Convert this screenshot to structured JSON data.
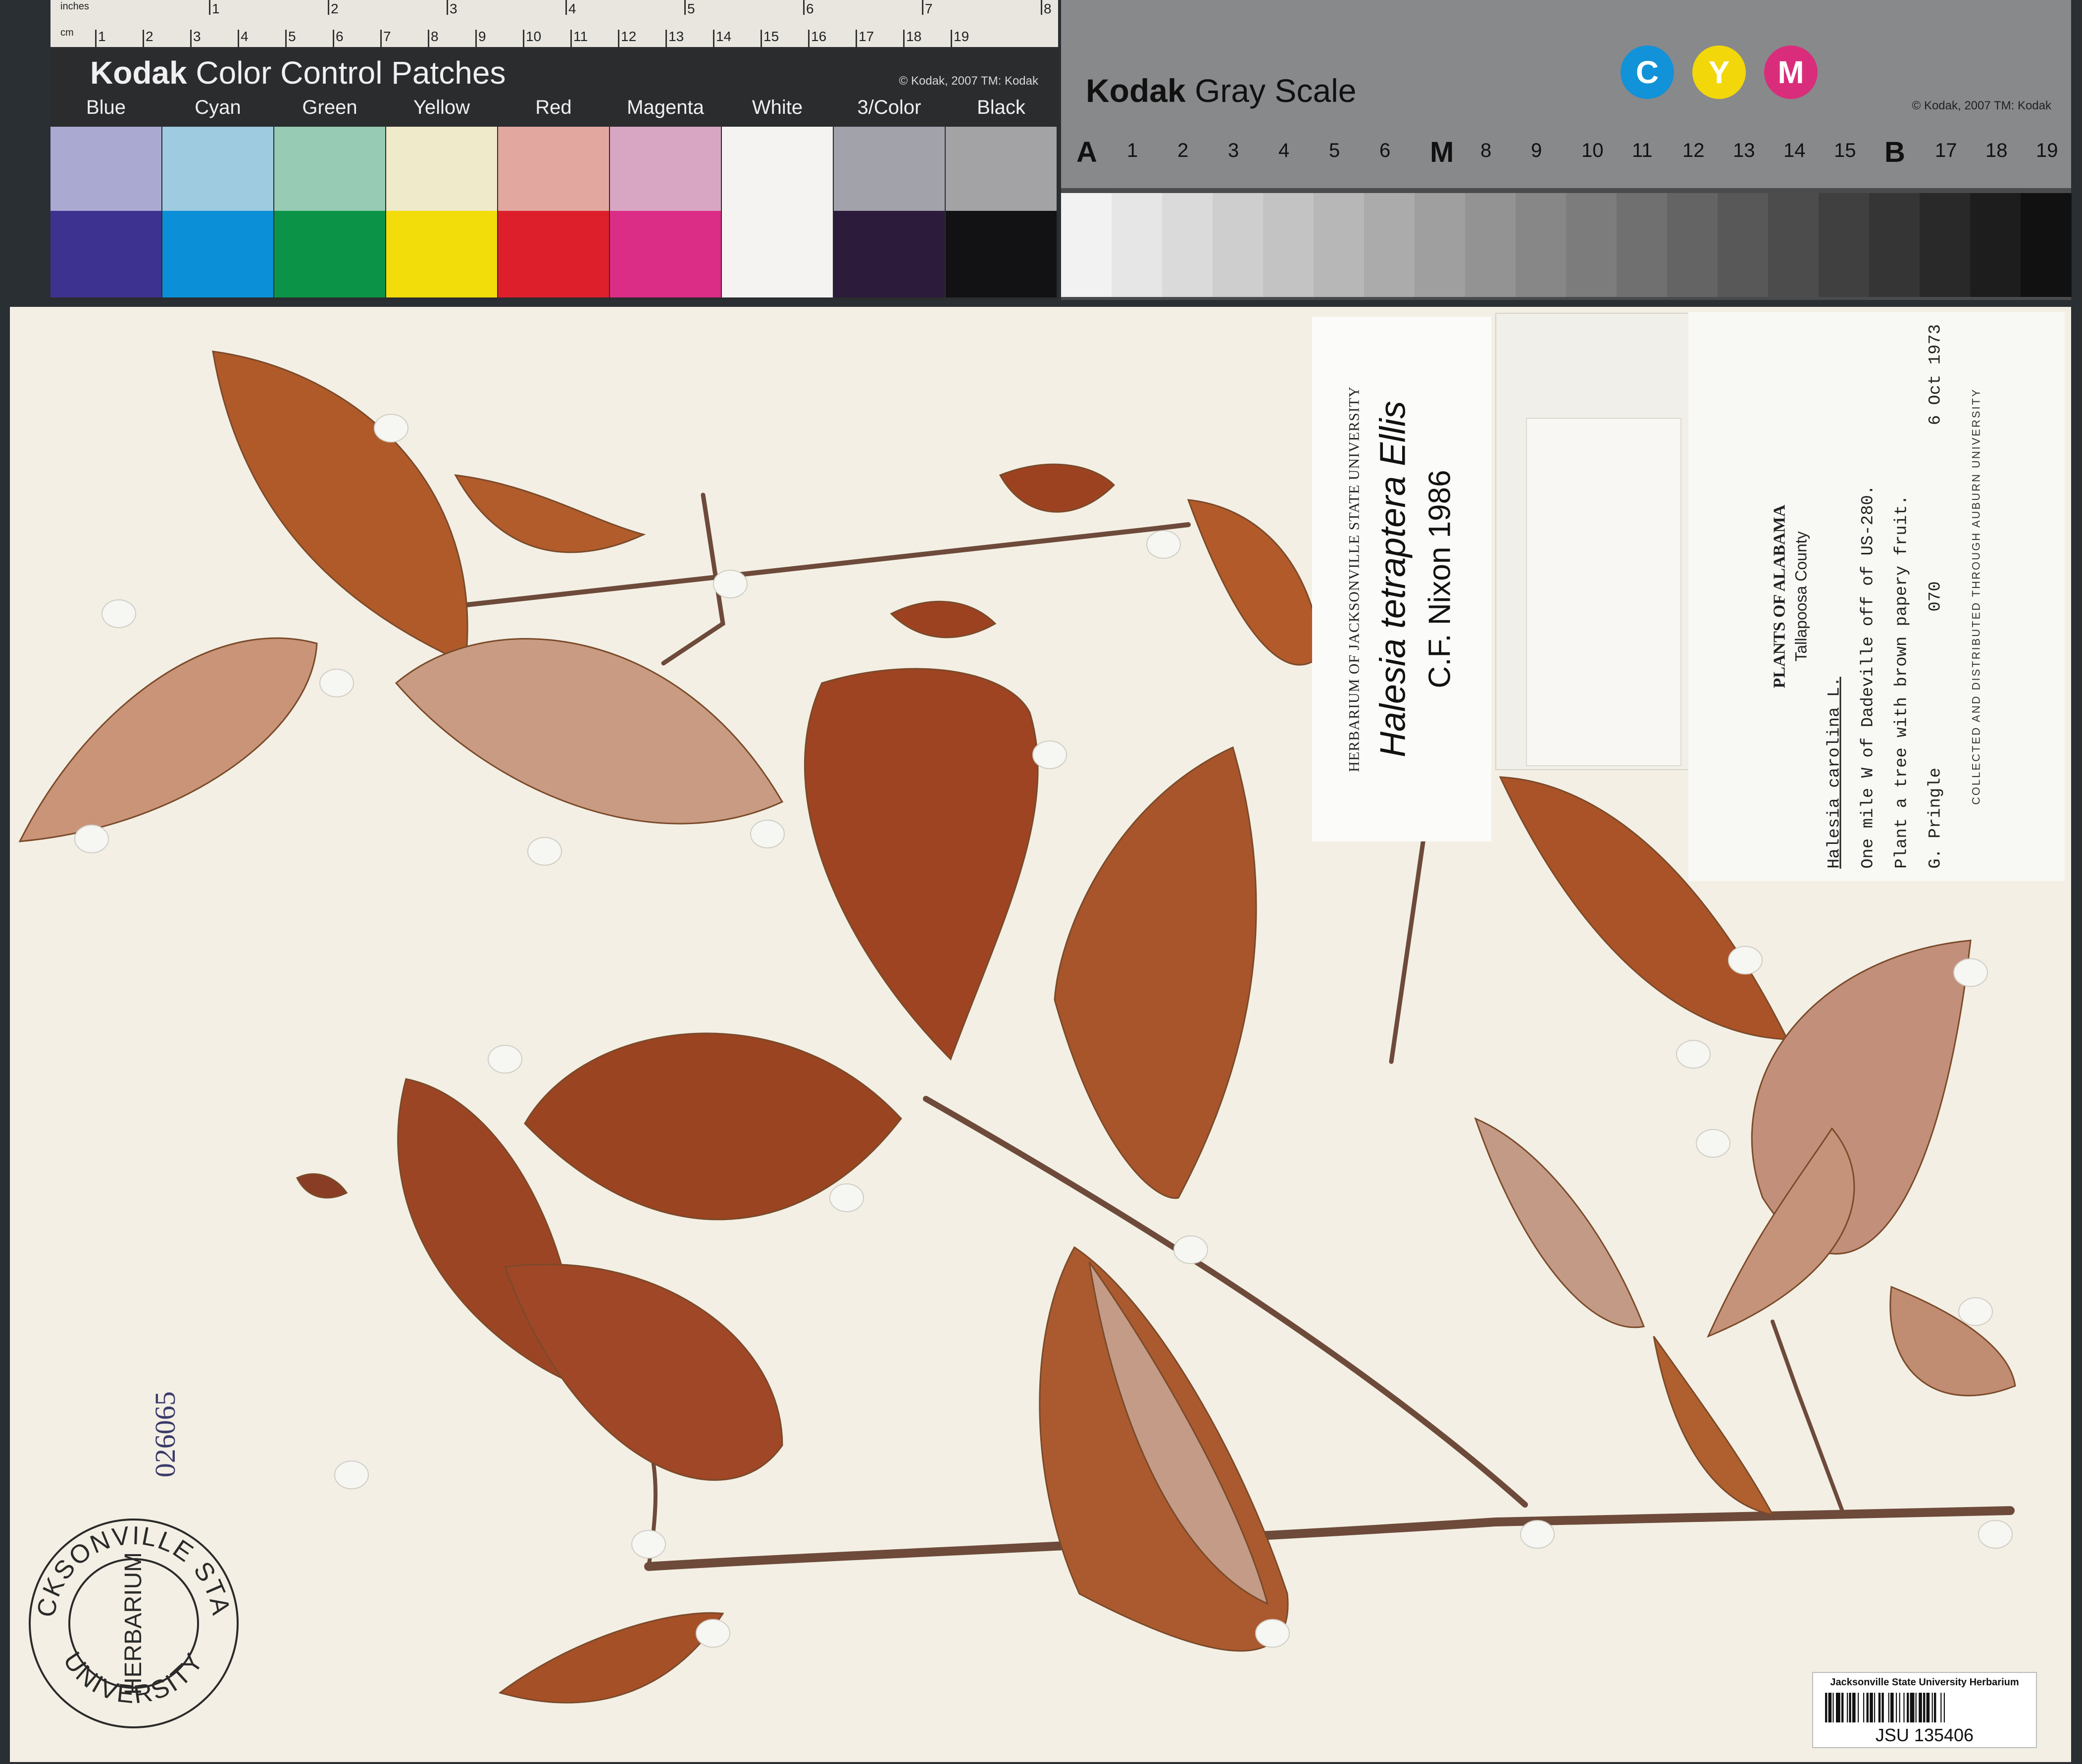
{
  "color_card": {
    "ruler": {
      "inches_label": "inches",
      "cm_label": "cm",
      "inch_marks": [
        "1",
        "2",
        "3",
        "4",
        "5",
        "6",
        "7",
        "8"
      ],
      "cm_marks": [
        "1",
        "2",
        "3",
        "4",
        "5",
        "6",
        "7",
        "8",
        "9",
        "10",
        "11",
        "12",
        "13",
        "14",
        "15",
        "16",
        "17",
        "18",
        "19"
      ]
    },
    "brand": "Kodak",
    "title": "Color Control Patches",
    "copyright": "© Kodak, 2007  TM: Kodak",
    "patches": [
      {
        "label": "Blue",
        "top": "#a9a9d2",
        "bottom": "#3e3290"
      },
      {
        "label": "Cyan",
        "top": "#9ecbe0",
        "bottom": "#0b8fd6"
      },
      {
        "label": "Green",
        "top": "#97cbb4",
        "bottom": "#0b9448"
      },
      {
        "label": "Yellow",
        "top": "#efeac9",
        "bottom": "#f2dd0b"
      },
      {
        "label": "Red",
        "top": "#e2a8a0",
        "bottom": "#dd1f2c"
      },
      {
        "label": "Magenta",
        "top": "#d8a6c2",
        "bottom": "#db2d86"
      },
      {
        "label": "White",
        "top": "#f4f3f1",
        "bottom": "#f4f3f1"
      },
      {
        "label": "3/Color",
        "top": "#a2a2ab",
        "bottom": "#2c1b3a"
      },
      {
        "label": "Black",
        "top": "#a3a3a5",
        "bottom": "#121214"
      }
    ]
  },
  "gray_card": {
    "brand": "Kodak",
    "title": "Gray Scale",
    "copyright": "© Kodak, 2007  TM: Kodak",
    "cym": [
      {
        "letter": "C",
        "color": "#1292d8"
      },
      {
        "letter": "Y",
        "color": "#f2d70a"
      },
      {
        "letter": "M",
        "color": "#d92d7b"
      }
    ],
    "steps": [
      "A",
      "1",
      "2",
      "3",
      "4",
      "5",
      "6",
      "M",
      "8",
      "9",
      "10",
      "11",
      "12",
      "13",
      "14",
      "15",
      "B",
      "17",
      "18",
      "19"
    ]
  },
  "determination_label": {
    "header": "HERBARIUM OF JACKSONVILLE STATE UNIVERSITY",
    "name": "Halesia tetraptera  Ellis",
    "determiner": "C.F. Nixon   1986"
  },
  "data_label": {
    "title": "PLANTS OF ALABAMA",
    "county": "Tallapoosa County",
    "taxon": "Halesia carolina L.",
    "locality": "One mile W of Dadeville off of US-280.",
    "habit": "Plant a tree with brown papery fruit.",
    "collector": "G. Pringle",
    "number": "070",
    "date": "6 Oct 1973",
    "footer": "COLLECTED AND DISTRIBUTED THROUGH AUBURN UNIVERSITY"
  },
  "stamp": {
    "top_text": "JACKSONVILLE STATE",
    "middle_text": "HERBARIUM",
    "bottom_text": "UNIVERSITY",
    "accession": "026065"
  },
  "barcode": {
    "institution": "Jacksonville State University Herbarium",
    "number": "JSU 135406"
  }
}
